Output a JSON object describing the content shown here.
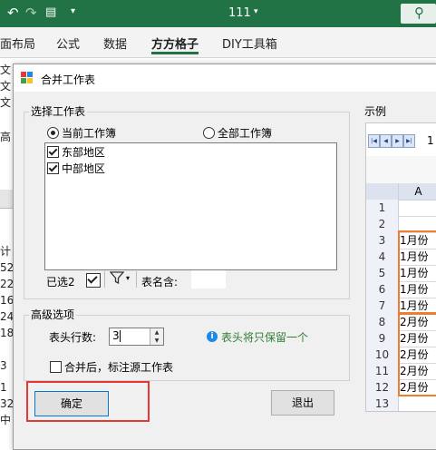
{
  "titlebar": {
    "title": "111",
    "search_icon": "search-icon"
  },
  "ribbon": {
    "tabs": [
      "面布局",
      "公式",
      "数据",
      "方方格子",
      "DIY工具箱"
    ],
    "active_index": 3
  },
  "left_strip": [
    "文",
    "文",
    "文",
    "高",
    "",
    "",
    "",
    "",
    "计",
    "52",
    "22",
    "16",
    "24",
    "18",
    "",
    "3",
    "",
    "1",
    "32",
    "中"
  ],
  "dialog": {
    "title": "合并工作表",
    "select_group": "选择工作表",
    "radio_current": "当前工作簿",
    "radio_all": "全部工作簿",
    "selected_radio": "current",
    "sheets": [
      {
        "label": "东部地区",
        "checked": true
      },
      {
        "label": "中部地区",
        "checked": true
      }
    ],
    "selected_count": "已选2",
    "sheet_name_label": "表名含:",
    "sheet_name_value": "",
    "advanced_group": "高级选项",
    "header_rows_label": "表头行数:",
    "header_rows_value": "3",
    "header_tip": "表头将只保留一个",
    "annotate_label": "合并后，标注源工作表",
    "annotate_checked": false,
    "ok_label": "确定",
    "exit_label": "退出",
    "example_label": "示例",
    "accent_red": "#e53935",
    "accent_orange": "#ed7d31"
  },
  "example": {
    "sheet_tab": "1",
    "col_header": "A",
    "rows": [
      {
        "n": "1",
        "v": ""
      },
      {
        "n": "2",
        "v": ""
      },
      {
        "n": "3",
        "v": "1月份"
      },
      {
        "n": "4",
        "v": "1月份"
      },
      {
        "n": "5",
        "v": "1月份"
      },
      {
        "n": "6",
        "v": "1月份"
      },
      {
        "n": "7",
        "v": "1月份"
      },
      {
        "n": "8",
        "v": "2月份"
      },
      {
        "n": "9",
        "v": "2月份"
      },
      {
        "n": "10",
        "v": "2月份"
      },
      {
        "n": "11",
        "v": "2月份"
      },
      {
        "n": "12",
        "v": "2月份"
      },
      {
        "n": "13",
        "v": ""
      }
    ]
  }
}
